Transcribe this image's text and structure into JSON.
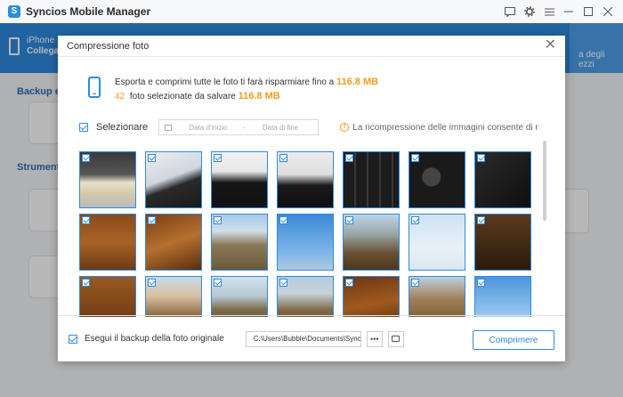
{
  "app": {
    "title": "Syncios Mobile Manager"
  },
  "device": {
    "name": "iPhone",
    "status": "Collegat"
  },
  "nav": {
    "active_tab_label_1": "a degli",
    "active_tab_label_2": "ezzi"
  },
  "background": {
    "section1": "Backup e r",
    "section2": "Strumento"
  },
  "dialog": {
    "title": "Compressione foto",
    "info": {
      "line1_text": "Esporta e comprimi tutte le foto ti farà risparmiare fino a",
      "line1_value": "116.8 MB",
      "count": "42",
      "line2_text": "foto selezionate da salvare",
      "line2_value": "116.8 MB"
    },
    "filter": {
      "select_label": "Selezionare",
      "date_start_placeholder": "Data d'inizio",
      "date_separator": "-",
      "date_end_placeholder": "Data di fine",
      "note": "La ricompressione delle immagini consente di rispa..."
    },
    "footer": {
      "backup_label": "Esegui il backup della foto originale",
      "path": "C:\\Users\\Bubble\\Documents\\Sync",
      "more_label": "•••",
      "compress_label": "Comprimere"
    }
  },
  "photos": [
    "keyboard-desk",
    "desk-screen",
    "laptop-cable",
    "laptop-cable-2",
    "keyboard-keys",
    "keyboard-win",
    "keyboard-ctrl",
    "aerial-autumn-forest",
    "aerial-autumn-hills",
    "aerial-river-bend",
    "aerial-blue-sky",
    "aerial-river-valley",
    "hazy-sky",
    "aerial-dark-forest",
    "aerial-autumn-forest-2",
    "aerial-town-road",
    "aerial-river-plain",
    "aerial-river-curve",
    "aerial-autumn-hills-2",
    "aerial-forest-plain",
    "blue-sky"
  ]
}
